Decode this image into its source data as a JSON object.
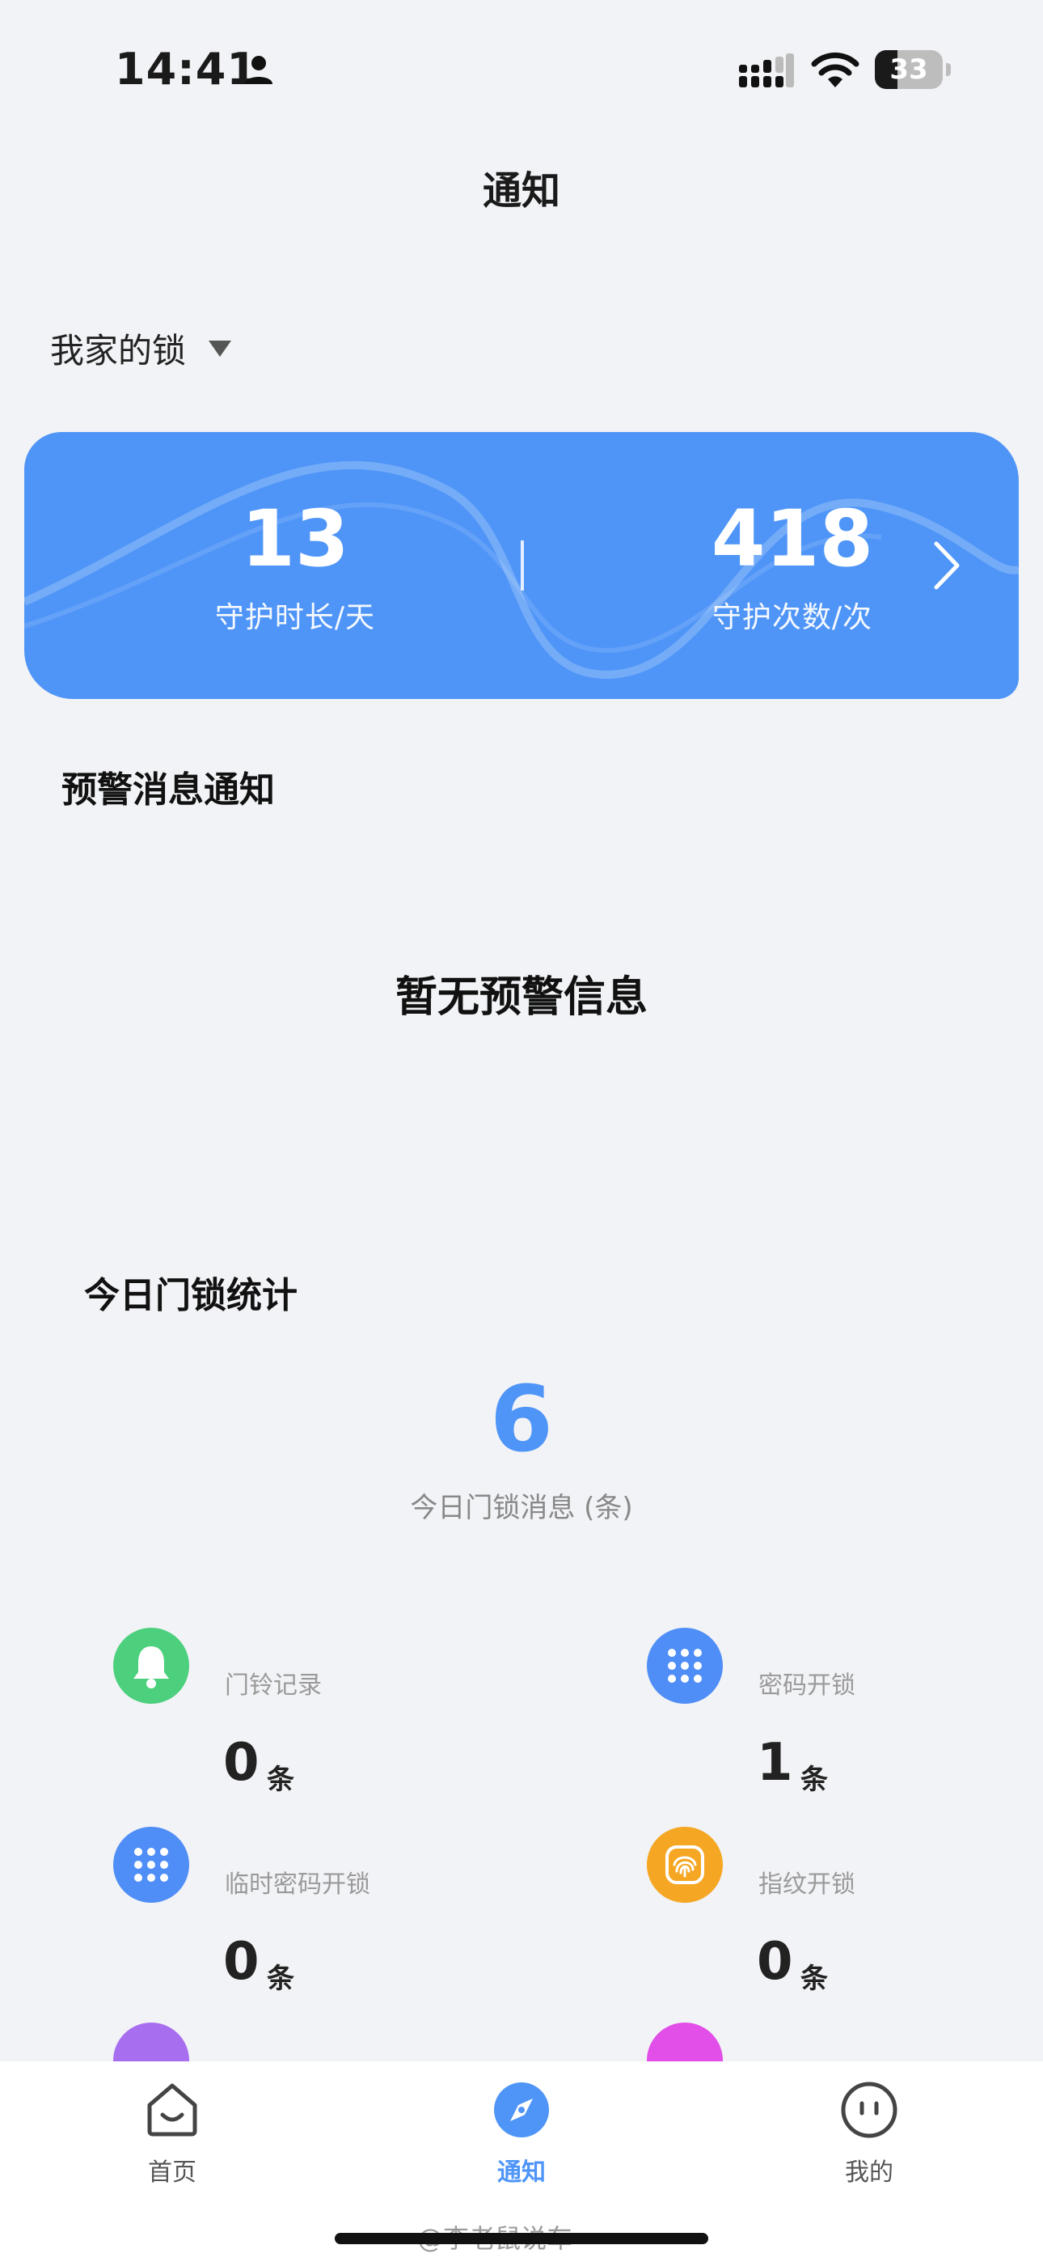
{
  "status_bar": {
    "time": "14:41",
    "battery": "33",
    "battery_level": 0.33
  },
  "page": {
    "title": "通知"
  },
  "lock_selector": {
    "label": "我家的锁"
  },
  "guard_card": {
    "days_value": "13",
    "days_label": "守护时长/天",
    "times_value": "418",
    "times_label": "守护次数/次"
  },
  "alerts": {
    "title": "预警消息通知",
    "empty_text": "暂无预警信息"
  },
  "today": {
    "title": "今日门锁统计",
    "count": "6",
    "count_label": "今日门锁消息 (条)",
    "items": [
      {
        "label": "门铃记录",
        "value": "0",
        "unit": "条",
        "icon": "bell-icon",
        "color": "#4cd07d"
      },
      {
        "label": "密码开锁",
        "value": "1",
        "unit": "条",
        "icon": "keypad-icon",
        "color": "#4f8ef7"
      },
      {
        "label": "临时密码开锁",
        "value": "0",
        "unit": "条",
        "icon": "keypad-icon",
        "color": "#4f8ef7"
      },
      {
        "label": "指纹开锁",
        "value": "0",
        "unit": "条",
        "icon": "fingerprint-icon",
        "color": "#f5a623"
      }
    ]
  },
  "tabs": [
    {
      "label": "首页",
      "icon": "home-icon"
    },
    {
      "label": "通知",
      "icon": "compass-icon",
      "active": true
    },
    {
      "label": "我的",
      "icon": "face-icon"
    }
  ],
  "watermark": "@李老鼠说车",
  "colors": {
    "accent": "#4f95f7",
    "background": "#f2f3f6"
  }
}
